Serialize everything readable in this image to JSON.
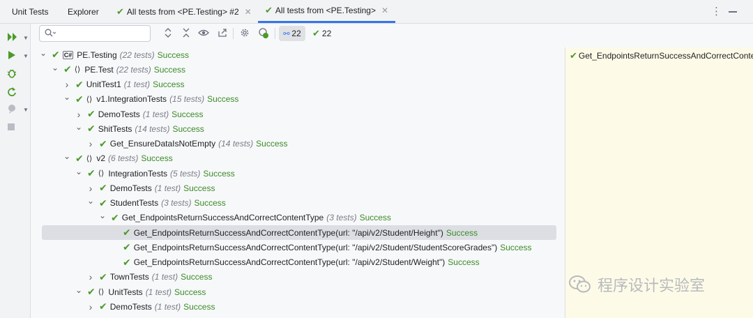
{
  "tabs": [
    {
      "label": "Unit Tests",
      "has_check": false,
      "closable": false,
      "active": false
    },
    {
      "label": "Explorer",
      "has_check": false,
      "closable": false,
      "active": false
    },
    {
      "label": "All tests from <PE.Testing> #2",
      "has_check": true,
      "closable": true,
      "active": false
    },
    {
      "label": "All tests from <PE.Testing>",
      "has_check": true,
      "closable": true,
      "active": true
    }
  ],
  "toolbar": {
    "search_placeholder": "",
    "passed_count": "22",
    "success_count": "22"
  },
  "tree": [
    {
      "level": 0,
      "expanded": true,
      "kind": "project",
      "name": "PE.Testing",
      "count": "(22 tests)",
      "status": "Success"
    },
    {
      "level": 1,
      "expanded": true,
      "kind": "namespace",
      "name": "PE.Test",
      "count": "(22 tests)",
      "status": "Success"
    },
    {
      "level": 2,
      "expanded": false,
      "kind": "class",
      "name": "UnitTest1",
      "count": "(1 test)",
      "status": "Success"
    },
    {
      "level": 2,
      "expanded": true,
      "kind": "namespace",
      "name": "v1.IntegrationTests",
      "count": "(15 tests)",
      "status": "Success"
    },
    {
      "level": 3,
      "expanded": false,
      "kind": "class",
      "name": "DemoTests",
      "count": "(1 test)",
      "status": "Success"
    },
    {
      "level": 3,
      "expanded": true,
      "kind": "class",
      "name": "ShitTests",
      "count": "(14 tests)",
      "status": "Success"
    },
    {
      "level": 4,
      "expanded": false,
      "kind": "method",
      "name": "Get_EnsureDataIsNotEmpty",
      "count": "(14 tests)",
      "status": "Success"
    },
    {
      "level": 2,
      "expanded": true,
      "kind": "namespace",
      "name": "v2",
      "count": "(6 tests)",
      "status": "Success"
    },
    {
      "level": 3,
      "expanded": true,
      "kind": "namespace",
      "name": "IntegrationTests",
      "count": "(5 tests)",
      "status": "Success"
    },
    {
      "level": 4,
      "expanded": false,
      "kind": "class",
      "name": "DemoTests",
      "count": "(1 test)",
      "status": "Success"
    },
    {
      "level": 4,
      "expanded": true,
      "kind": "class",
      "name": "StudentTests",
      "count": "(3 tests)",
      "status": "Success"
    },
    {
      "level": 5,
      "expanded": true,
      "kind": "method",
      "name": "Get_EndpointsReturnSuccessAndCorrectContentType",
      "count": "(3 tests)",
      "status": "Success"
    },
    {
      "level": 6,
      "expanded": null,
      "kind": "case",
      "name": "Get_EndpointsReturnSuccessAndCorrectContentType(url: \"/api/v2/Student/Height\")",
      "count": "",
      "status": "Success",
      "selected": true
    },
    {
      "level": 6,
      "expanded": null,
      "kind": "case",
      "name": "Get_EndpointsReturnSuccessAndCorrectContentType(url: \"/api/v2/Student/StudentScoreGrades\")",
      "count": "",
      "status": "Success"
    },
    {
      "level": 6,
      "expanded": null,
      "kind": "case",
      "name": "Get_EndpointsReturnSuccessAndCorrectContentType(url: \"/api/v2/Student/Weight\")",
      "count": "",
      "status": "Success"
    },
    {
      "level": 4,
      "expanded": false,
      "kind": "class",
      "name": "TownTests",
      "count": "(1 test)",
      "status": "Success"
    },
    {
      "level": 3,
      "expanded": true,
      "kind": "namespace",
      "name": "UnitTests",
      "count": "(1 test)",
      "status": "Success"
    },
    {
      "level": 4,
      "expanded": false,
      "kind": "class",
      "name": "DemoTests",
      "count": "(1 test)",
      "status": "Success"
    }
  ],
  "detail": {
    "text": "Get_EndpointsReturnSuccessAndCorrectContentType"
  },
  "watermark": {
    "text": "程序设计实验室"
  },
  "colors": {
    "success": "#4c9a2a",
    "accent": "#3574f0",
    "detail_bg": "#fdfbe8"
  }
}
